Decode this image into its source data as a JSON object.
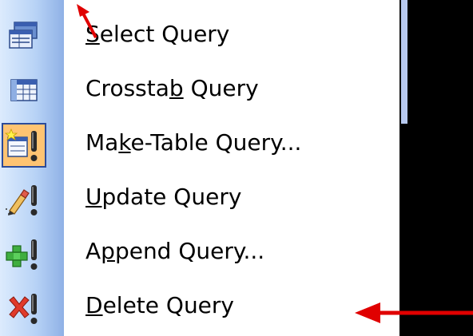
{
  "menu": {
    "items": [
      {
        "label_mnemonic": "S",
        "label_rest": "elect Query",
        "icon": "select-query-icon"
      },
      {
        "label_pre": "Crossta",
        "label_mnemonic": "b",
        "label_rest": " Query",
        "icon": "crosstab-query-icon"
      },
      {
        "label_pre": "Ma",
        "label_mnemonic": "k",
        "label_rest": "e-Table Query...",
        "icon": "make-table-query-icon",
        "selected": true
      },
      {
        "label_mnemonic": "U",
        "label_rest": "pdate Query",
        "icon": "update-query-icon"
      },
      {
        "label_pre": "A",
        "label_mnemonic": "p",
        "label_rest": "pend Query...",
        "icon": "append-query-icon"
      },
      {
        "label_mnemonic": "D",
        "label_rest": "elete Query",
        "icon": "delete-query-icon"
      }
    ]
  },
  "colors": {
    "background": "#000000",
    "menu_bg": "#ffffff",
    "gutter": "#b8d3f6",
    "selected_highlight": "#ffc472",
    "selected_border": "#2b4b9a",
    "annotation_arrow": "#e00000"
  }
}
